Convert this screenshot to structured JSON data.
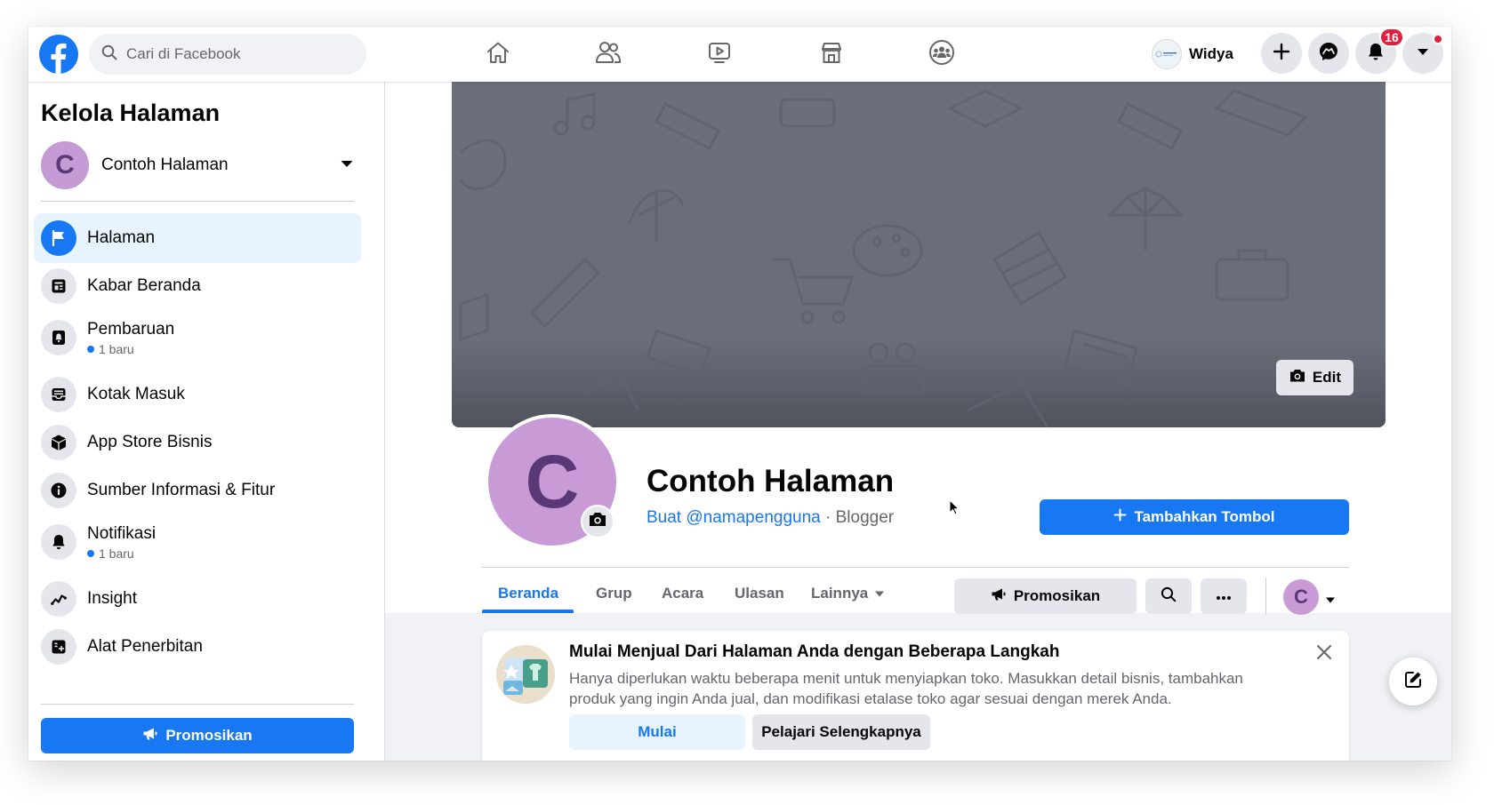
{
  "topbar": {
    "search_placeholder": "Cari di Facebook",
    "nav_tabs": [
      "home-icon",
      "friends-icon",
      "watch-icon",
      "marketplace-icon",
      "groups-icon"
    ],
    "profile_name": "Widya",
    "notification_count": "16"
  },
  "sidebar": {
    "title": "Kelola Halaman",
    "page_name": "Contoh Halaman",
    "page_initial": "C",
    "items": [
      {
        "label": "Halaman",
        "icon": "flag-icon",
        "active": true
      },
      {
        "label": "Kabar Beranda",
        "icon": "news-feed-icon"
      },
      {
        "label": "Pembaruan",
        "icon": "updates-icon",
        "sub": "1 baru"
      },
      {
        "label": "Kotak Masuk",
        "icon": "inbox-icon"
      },
      {
        "label": "App Store Bisnis",
        "icon": "box-icon"
      },
      {
        "label": "Sumber Informasi & Fitur",
        "icon": "info-icon"
      },
      {
        "label": "Notifikasi",
        "icon": "bell-icon",
        "sub": "1 baru"
      },
      {
        "label": "Insight",
        "icon": "insight-icon"
      },
      {
        "label": "Alat Penerbitan",
        "icon": "publishing-tools-icon"
      }
    ],
    "promote_label": "Promosikan"
  },
  "profile": {
    "edit_cover_label": "Edit",
    "initial": "C",
    "name": "Contoh Halaman",
    "username_link": "Buat @namapengguna",
    "separator": " · ",
    "category": "Blogger",
    "add_button_label": "Tambahkan Tombol"
  },
  "tabs": {
    "items": [
      "Beranda",
      "Grup",
      "Acara",
      "Ulasan",
      "Lainnya"
    ],
    "active": "Beranda",
    "promote_label": "Promosikan"
  },
  "shop_card": {
    "title": "Mulai Menjual Dari Halaman Anda dengan Beberapa Langkah",
    "description": "Hanya diperlukan waktu beberapa menit untuk menyiapkan toko. Masukkan detail bisnis, tambahkan produk yang ingin Anda jual, dan modifikasi etalase toko agar sesuai dengan merek Anda.",
    "primary_label": "Mulai",
    "secondary_label": "Pelajari Selengkapnya"
  },
  "colors": {
    "brand_blue": "#1877f2",
    "avatar_purple": "#c99bd6",
    "badge_red": "#e41e3f",
    "cover_gray": "#6b6f7b"
  }
}
